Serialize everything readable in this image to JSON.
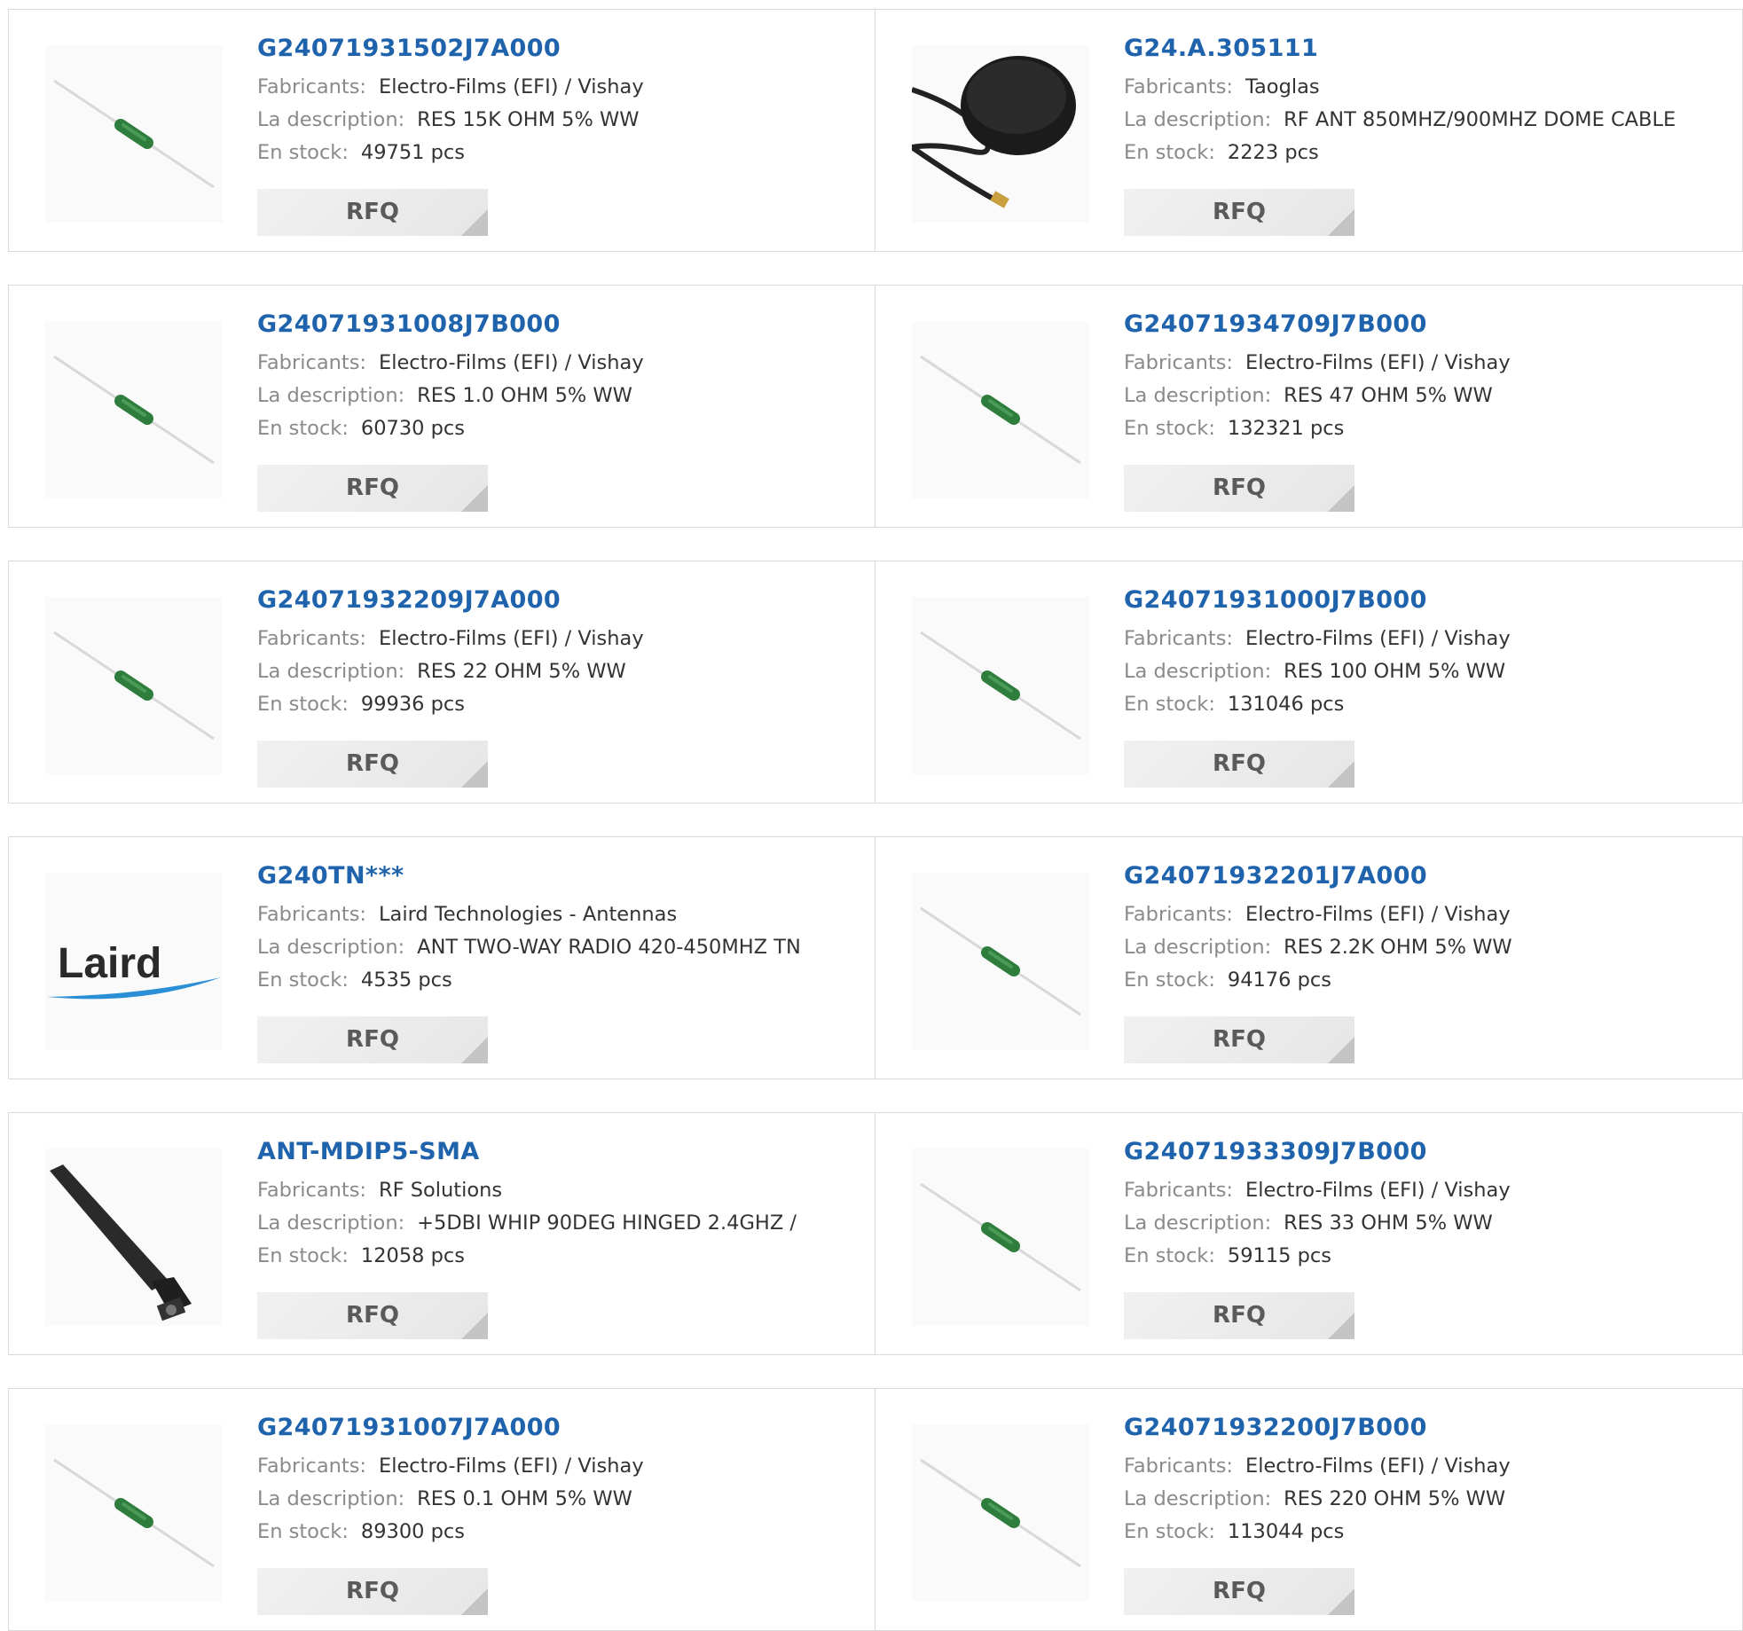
{
  "labels": {
    "manufacturer": "Fabricants:",
    "description": "La description:",
    "stock": "En stock:",
    "rfq": "RFQ"
  },
  "rows": [
    [
      {
        "part": "G24071931502J7A000",
        "manufacturer": "Electro-Films (EFI) / Vishay",
        "description": "RES 15K OHM 5% WW",
        "stock": "49751 pcs",
        "image": "resistor-image"
      },
      {
        "part": "G24.A.305111",
        "manufacturer": "Taoglas",
        "description": "RF ANT 850MHZ/900MHZ DOME CABLE",
        "stock": "2223 pcs",
        "image": "dome-antenna-image"
      }
    ],
    [
      {
        "part": "G24071931008J7B000",
        "manufacturer": "Electro-Films (EFI) / Vishay",
        "description": "RES 1.0 OHM 5% WW",
        "stock": "60730 pcs",
        "image": "resistor-image"
      },
      {
        "part": "G24071934709J7B000",
        "manufacturer": "Electro-Films (EFI) / Vishay",
        "description": "RES 47 OHM 5% WW",
        "stock": "132321 pcs",
        "image": "resistor-image"
      }
    ],
    [
      {
        "part": "G24071932209J7A000",
        "manufacturer": "Electro-Films (EFI) / Vishay",
        "description": "RES 22 OHM 5% WW",
        "stock": "99936 pcs",
        "image": "resistor-image"
      },
      {
        "part": "G24071931000J7B000",
        "manufacturer": "Electro-Films (EFI) / Vishay",
        "description": "RES 100 OHM 5% WW",
        "stock": "131046 pcs",
        "image": "resistor-image"
      }
    ],
    [
      {
        "part": "G240TN***",
        "manufacturer": "Laird Technologies - Antennas",
        "description": "ANT TWO-WAY RADIO 420-450MHZ TN",
        "stock": "4535 pcs",
        "image": "laird-logo",
        "logo_text": "Laird"
      },
      {
        "part": "G24071932201J7A000",
        "manufacturer": "Electro-Films (EFI) / Vishay",
        "description": "RES 2.2K OHM 5% WW",
        "stock": "94176 pcs",
        "image": "resistor-image"
      }
    ],
    [
      {
        "part": "ANT-MDIP5-SMA",
        "manufacturer": "RF Solutions",
        "description": "+5DBI WHIP 90DEG HINGED 2.4GHZ /",
        "stock": "12058 pcs",
        "image": "whip-antenna-image"
      },
      {
        "part": "G24071933309J7B000",
        "manufacturer": "Electro-Films (EFI) / Vishay",
        "description": "RES 33 OHM 5% WW",
        "stock": "59115 pcs",
        "image": "resistor-image"
      }
    ],
    [
      {
        "part": "G24071931007J7A000",
        "manufacturer": "Electro-Films (EFI) / Vishay",
        "description": "RES 0.1 OHM 5% WW",
        "stock": "89300 pcs",
        "image": "resistor-image"
      },
      {
        "part": "G24071932200J7B000",
        "manufacturer": "Electro-Films (EFI) / Vishay",
        "description": "RES 220 OHM 5% WW",
        "stock": "113044 pcs",
        "image": "resistor-image"
      }
    ]
  ],
  "colors": {
    "link": "#1f63ad",
    "label": "#8a8a8a",
    "value": "#333333",
    "resistor_body": "#2e7d3c",
    "border": "#d9d9d9",
    "button_bg": "#eeeeee"
  }
}
